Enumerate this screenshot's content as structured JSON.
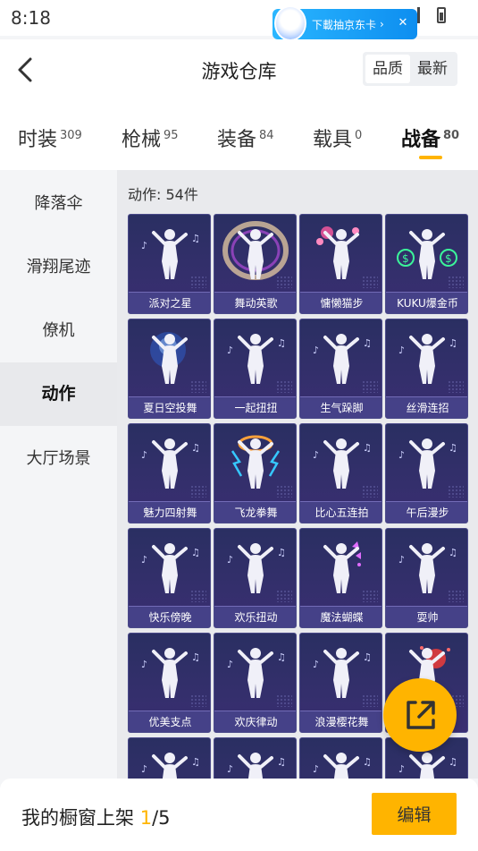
{
  "status": {
    "time": "8:18"
  },
  "promo": {
    "text": "下載抽京东卡",
    "chevron": "›",
    "close": "✕"
  },
  "header": {
    "title": "游戏仓库",
    "sort": [
      "品质",
      "最新"
    ]
  },
  "tabs": [
    {
      "label": "时装",
      "count": "309"
    },
    {
      "label": "枪械",
      "count": "95"
    },
    {
      "label": "装备",
      "count": "84"
    },
    {
      "label": "载具",
      "count": "0"
    },
    {
      "label": "战备",
      "count": "80"
    }
  ],
  "active_tab": "战备",
  "sidebar": {
    "items": [
      "降落伞",
      "滑翔尾迹",
      "僚机",
      "动作",
      "大厅场景"
    ],
    "active": "动作"
  },
  "section": {
    "label": "动作: 54件"
  },
  "items": [
    {
      "label": "派对之星",
      "effect": "none"
    },
    {
      "label": "舞动英歌",
      "effect": "swirl"
    },
    {
      "label": "慵懒猫步",
      "effect": "hearts"
    },
    {
      "label": "KUKU爆金币",
      "effect": "money"
    },
    {
      "label": "夏日空投舞",
      "effect": "blue-glow"
    },
    {
      "label": "一起扭扭",
      "effect": "none"
    },
    {
      "label": "生气跺脚",
      "effect": "none"
    },
    {
      "label": "丝滑连招",
      "effect": "none"
    },
    {
      "label": "魅力四射舞",
      "effect": "none"
    },
    {
      "label": "飞龙拳舞",
      "effect": "lightning"
    },
    {
      "label": "比心五连拍",
      "effect": "none"
    },
    {
      "label": "午后漫步",
      "effect": "none"
    },
    {
      "label": "快乐傍晚",
      "effect": "none"
    },
    {
      "label": "欢乐扭动",
      "effect": "none"
    },
    {
      "label": "魔法蝴蝶",
      "effect": "butterfly"
    },
    {
      "label": "耍帅",
      "effect": "none"
    },
    {
      "label": "优美支点",
      "effect": "none"
    },
    {
      "label": "欢庆律动",
      "effect": "none"
    },
    {
      "label": "浪漫樱花舞",
      "effect": "none"
    },
    {
      "label": "",
      "effect": "red-orb"
    },
    {
      "label": "",
      "effect": "none"
    },
    {
      "label": "",
      "effect": "none"
    },
    {
      "label": "",
      "effect": "none"
    },
    {
      "label": "",
      "effect": "none"
    }
  ],
  "fab": {
    "icon": "share-external-icon"
  },
  "bottom": {
    "prefix": "我的橱窗上架 ",
    "current": "1",
    "suffix": "/5",
    "edit": "编辑"
  },
  "colors": {
    "accent": "#ffb400",
    "card_bg": "#2f2f6a",
    "label_bg": "#48448c"
  }
}
